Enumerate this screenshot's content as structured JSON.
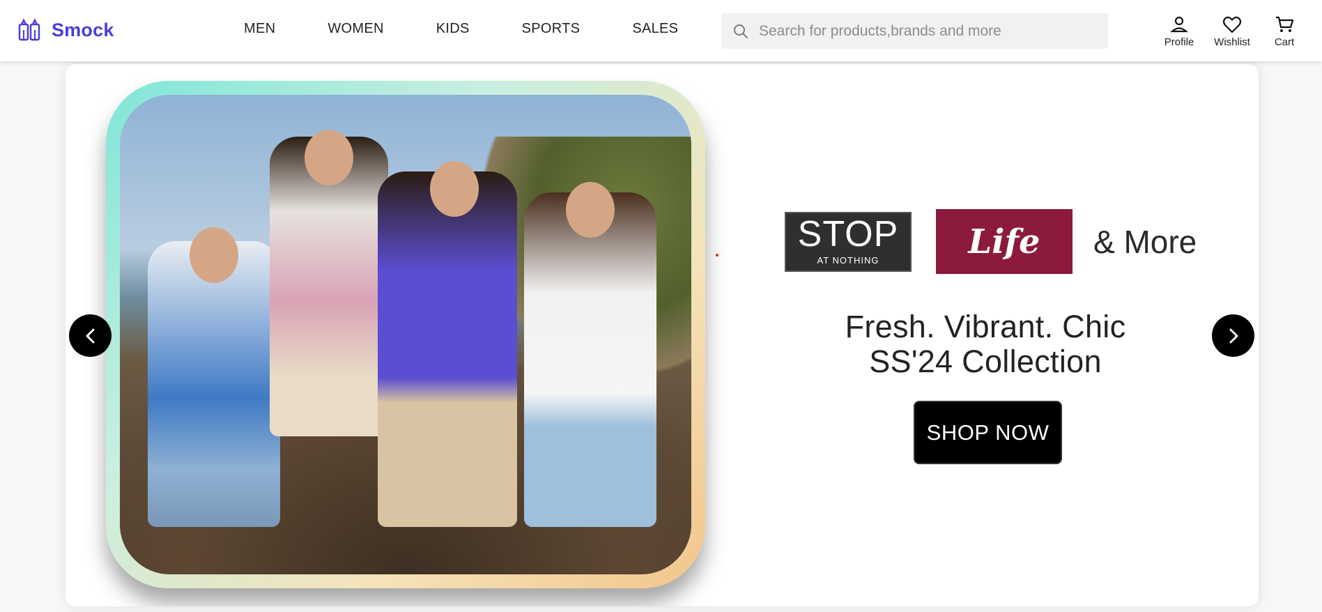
{
  "brand": {
    "name": "Smock",
    "logo_icon": "store-logo-icon",
    "color": "#4a3ed6"
  },
  "nav": {
    "items": [
      "MEN",
      "WOMEN",
      "KIDS",
      "SPORTS",
      "SALES"
    ]
  },
  "search": {
    "placeholder": "Search for products,brands and more",
    "icon": "search-icon"
  },
  "actions": {
    "profile": "Profile",
    "wishlist": "Wishlist",
    "cart": "Cart"
  },
  "banner": {
    "brand_stop_main": "STOP",
    "brand_stop_sub": "AT NOTHING",
    "brand_life": "Life",
    "and_more": "& More",
    "headline_line1": "Fresh. Vibrant. Chic",
    "headline_line2": "SS'24 Collection",
    "cta": "SHOP NOW",
    "colors": {
      "life_bg": "#8c1a3c",
      "stop_bg": "#2f2f2f",
      "cta_bg": "#000000"
    }
  },
  "carousel": {
    "prev_icon": "chevron-left-icon",
    "next_icon": "chevron-right-icon"
  }
}
